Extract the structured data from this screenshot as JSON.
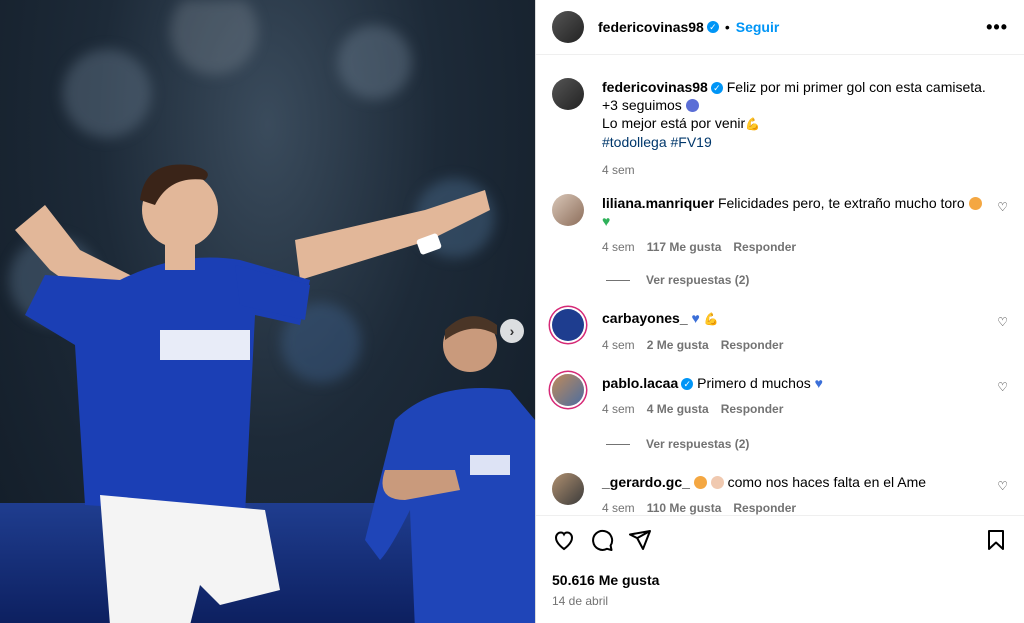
{
  "post": {
    "username": "federicovinas98",
    "follow_label": "Seguir",
    "dot": "•",
    "more_label": "•••"
  },
  "caption": {
    "username": "federicovinas98",
    "line1": "Feliz por mi primer gol con esta camiseta.",
    "line2": "+3 seguimos",
    "line3": "Lo mejor está por venir",
    "hashtags": "#todollega #FV19",
    "time": "4 sem"
  },
  "comments": [
    {
      "username": "liliana.manriquer",
      "text": "Felicidades pero, te extraño mucho toro",
      "time": "4 sem",
      "likes": "117 Me gusta",
      "reply": "Responder"
    },
    {
      "username": "carbayones_",
      "text": "",
      "time": "4 sem",
      "likes": "2 Me gusta",
      "reply": "Responder"
    },
    {
      "username": "pablo.lacaa",
      "text": "Primero d muchos",
      "time": "4 sem",
      "likes": "4 Me gusta",
      "reply": "Responder"
    },
    {
      "username": "_gerardo.gc_",
      "text": "como nos haces falta en el Ame",
      "time": "4 sem",
      "likes": "110 Me gusta",
      "reply": "Responder"
    }
  ],
  "view_replies_1": "Ver respuestas (2)",
  "view_replies_2": "Ver respuestas (2)",
  "likes_total": "50.616 Me gusta",
  "date": "14 de abril",
  "colors": {
    "accent": "#0095f6",
    "hashtag": "#00376b",
    "muted": "#737373"
  }
}
